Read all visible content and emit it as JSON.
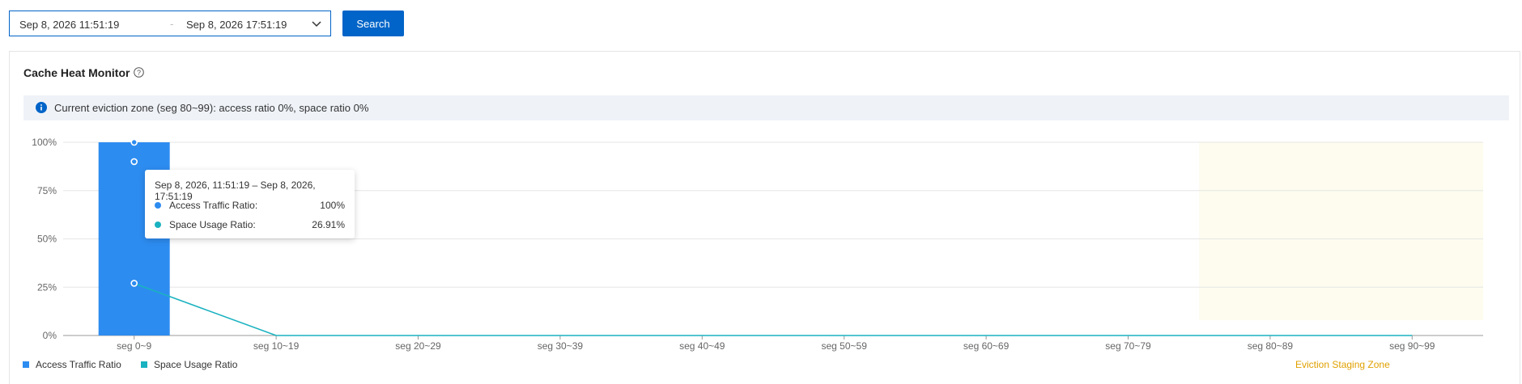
{
  "date_range": {
    "start": "Sep 8, 2026 11:51:19",
    "separator": "-",
    "end": "Sep 8, 2026 17:51:19"
  },
  "search_label": "Search",
  "card": {
    "title": "Cache Heat Monitor",
    "notice": "Current eviction zone (seg 80~99): access ratio 0%, space ratio 0%"
  },
  "tooltip": {
    "title": "Sep 8, 2026, 11:51:19 – Sep 8, 2026, 17:51:19",
    "rows": [
      {
        "label": "Access Traffic Ratio:",
        "value": "100%"
      },
      {
        "label": "Space Usage Ratio:",
        "value": "26.91%"
      }
    ]
  },
  "legend": [
    {
      "label": "Access Traffic Ratio",
      "color": "#2d8cf0"
    },
    {
      "label": "Space Usage Ratio",
      "color": "#1ab2c0"
    }
  ],
  "zone_label": "Eviction Staging Zone",
  "colors": {
    "accent": "#0064c8",
    "bar": "#2d8cf0",
    "line": "#1ab2c0",
    "zone_fill": "#fdfcef",
    "zone_text": "#e0a000"
  },
  "chart_data": {
    "type": "bar",
    "categories": [
      "seg 0~9",
      "seg 10~19",
      "seg 20~29",
      "seg 30~39",
      "seg 40~49",
      "seg 50~59",
      "seg 60~69",
      "seg 70~79",
      "seg 80~89",
      "seg 90~99"
    ],
    "series": [
      {
        "name": "Access Traffic Ratio",
        "type": "bar",
        "values": [
          100,
          0,
          0,
          0,
          0,
          0,
          0,
          0,
          0,
          0
        ]
      },
      {
        "name": "Space Usage Ratio",
        "type": "line",
        "values": [
          26.91,
          0,
          0,
          0,
          0,
          0,
          0,
          0,
          0,
          0
        ]
      }
    ],
    "extra_points_seg0": [
      100,
      90,
      27
    ],
    "ylim": [
      0,
      100
    ],
    "yticks": [
      "0%",
      "25%",
      "50%",
      "75%",
      "100%"
    ],
    "ytick_values": [
      0,
      25,
      50,
      75,
      100
    ],
    "highlight_zone": {
      "from": "seg 80~89",
      "to": "seg 90~99",
      "label": "Eviction Staging Zone"
    },
    "grid": true,
    "legend_position": "bottom-left"
  }
}
